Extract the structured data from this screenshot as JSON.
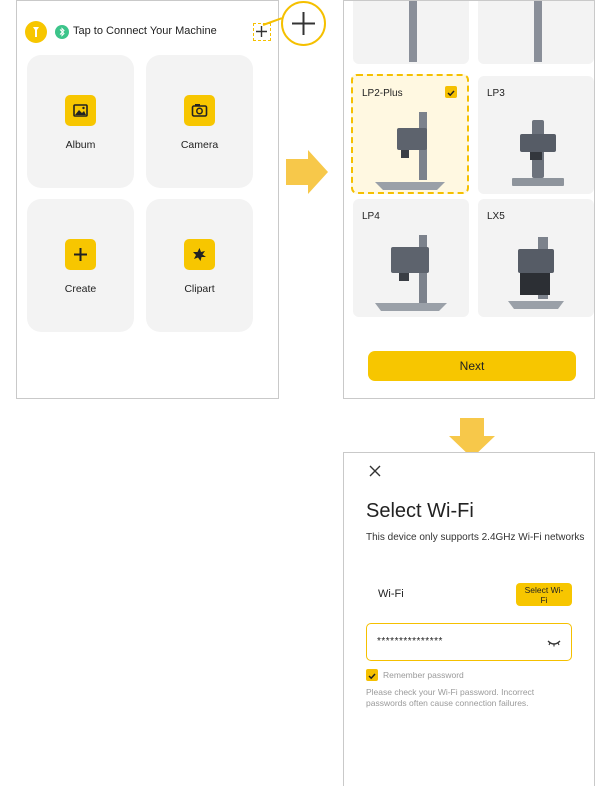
{
  "screen1": {
    "connect_text": "Tap to Connect Your Machine",
    "tiles": [
      {
        "label": "Album",
        "icon": "image-icon"
      },
      {
        "label": "Camera",
        "icon": "camera-icon"
      },
      {
        "label": "Create",
        "icon": "plus-icon"
      },
      {
        "label": "Clipart",
        "icon": "clipart-icon"
      }
    ]
  },
  "screen2": {
    "machines": [
      {
        "name": "LP2-Plus",
        "selected": true
      },
      {
        "name": "LP3",
        "selected": false
      },
      {
        "name": "LP4",
        "selected": false
      },
      {
        "name": "LX5",
        "selected": false
      }
    ],
    "next_label": "Next"
  },
  "screen3": {
    "title": "Select Wi-Fi",
    "subtitle": "This device only supports 2.4GHz Wi-Fi networks",
    "wifi_label": "Wi-Fi",
    "select_wifi_label": "Select Wi-Fi",
    "password_value": "***************",
    "remember_label": "Remember password",
    "note": "Please check your Wi-Fi password. Incorrect passwords often cause connection failures."
  },
  "colors": {
    "accent": "#f7c600",
    "tile_bg": "#f3f3f3",
    "selected_bg": "#fff8e1",
    "bluetooth": "#3cc48a"
  }
}
